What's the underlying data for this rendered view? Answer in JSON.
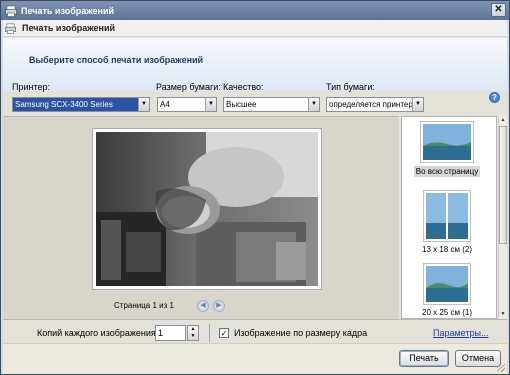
{
  "window": {
    "title": "Печать изображений",
    "header_title": "Печать изображений"
  },
  "banner": {
    "instruction": "Выберите способ печати изображений"
  },
  "fields": {
    "printer": {
      "label": "Принтер:",
      "value": "Samsung SCX-3400 Series"
    },
    "paper_size": {
      "label": "Размер бумаги:",
      "value": "A4"
    },
    "quality": {
      "label": "Качество:",
      "value": "Высшее"
    },
    "paper_type": {
      "label": "Тип бумаги:",
      "value": "определяется принтер"
    }
  },
  "preview": {
    "page_label": "Страница 1 из 1"
  },
  "layouts": [
    {
      "label": "Во всю страницу",
      "selected": true
    },
    {
      "label": "13 x 18 см (2)",
      "selected": false
    },
    {
      "label": "20 x 25 см (1)",
      "selected": false
    }
  ],
  "options": {
    "copies_label": "Копий каждого изображения:",
    "copies_value": "1",
    "fit_label": "Изображение по размеру кадра",
    "fit_checked_glyph": "✓",
    "params_link": "Параметры..."
  },
  "buttons": {
    "print": "Печать",
    "cancel": "Отмена"
  },
  "icons": {
    "close": "✕",
    "help": "?",
    "prev": "◀",
    "next": "▶"
  }
}
